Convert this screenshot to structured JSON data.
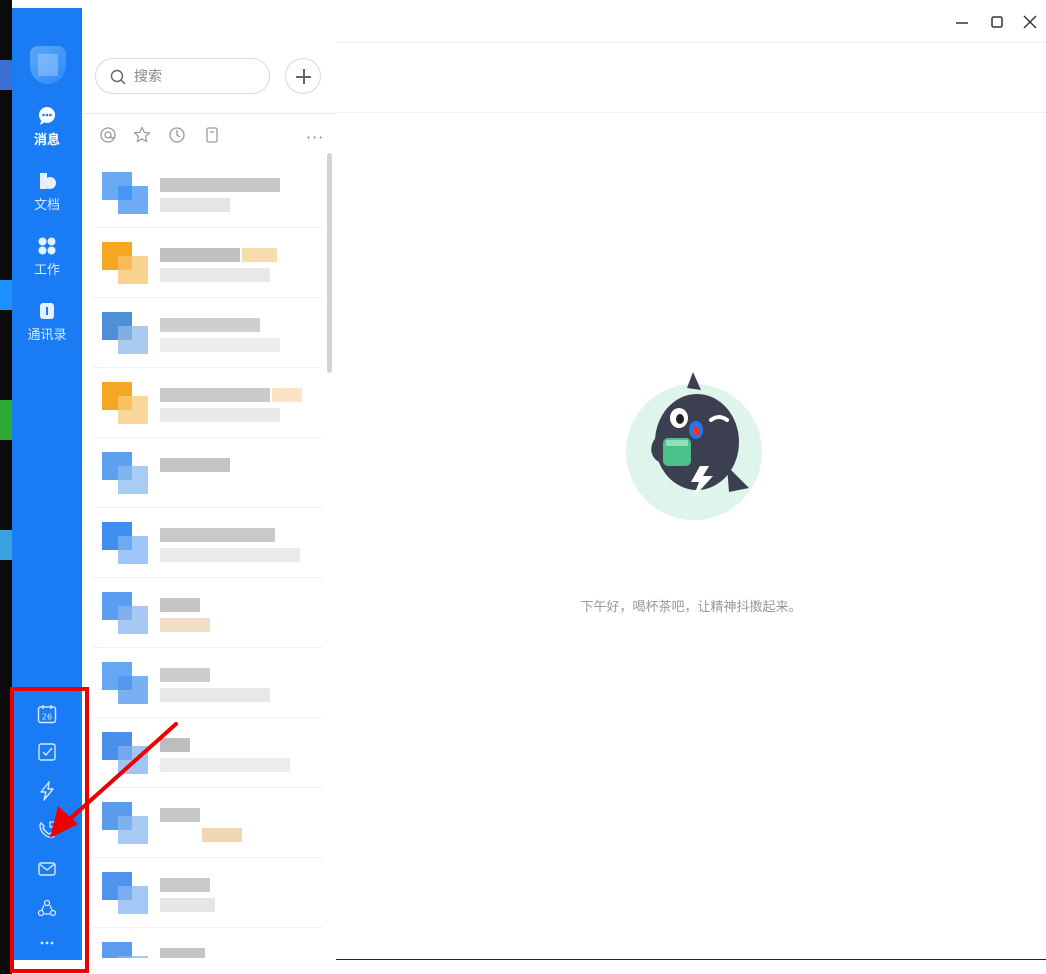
{
  "nav": {
    "items": [
      {
        "label": "消息",
        "icon": "message-icon",
        "active": true
      },
      {
        "label": "文档",
        "icon": "document-icon",
        "active": false
      },
      {
        "label": "工作",
        "icon": "workspace-icon",
        "active": false
      },
      {
        "label": "通讯录",
        "icon": "contacts-icon",
        "active": false
      }
    ],
    "bottom": [
      {
        "icon": "calendar-icon",
        "badge": "26"
      },
      {
        "icon": "todo-icon"
      },
      {
        "icon": "flash-icon"
      },
      {
        "icon": "phone-call-icon"
      },
      {
        "icon": "mail-icon"
      },
      {
        "icon": "team-icon"
      },
      {
        "icon": "more-apps-icon"
      }
    ]
  },
  "search": {
    "placeholder": "搜索"
  },
  "filters": [
    "at-icon",
    "star-icon",
    "clock-icon",
    "bookmark-icon"
  ],
  "main": {
    "greeting": "下午好，喝杯茶吧，让精神抖擞起来。"
  },
  "colors": {
    "sidebar": "#1a7cf5",
    "annotation": "#e00000",
    "background": "#ffffff"
  }
}
